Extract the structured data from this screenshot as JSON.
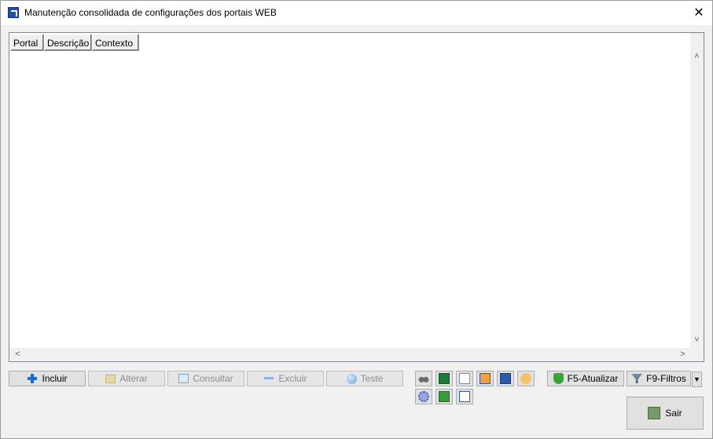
{
  "window": {
    "title": "Manutenção consolidada de configurações dos portais WEB",
    "close_glyph": "✕"
  },
  "grid": {
    "columns": [
      "Portal",
      "Descrição",
      "Contexto"
    ],
    "rows": []
  },
  "scroll": {
    "up": "˄",
    "down": "˅",
    "left": "<",
    "right": ">"
  },
  "actions": {
    "incluir": "Incluir",
    "alterar": "Alterar",
    "consultar": "Consultar",
    "excluir": "Excluir",
    "teste": "Teste"
  },
  "toolbar": {
    "atualizar": "F5-Atualizar",
    "filtros": "F9-Filtros",
    "dropdown_glyph": "▼",
    "sair": "Sair"
  },
  "colors": {
    "accent_blue": "#1a6ad6",
    "disabled_text": "#8d8d8d"
  }
}
